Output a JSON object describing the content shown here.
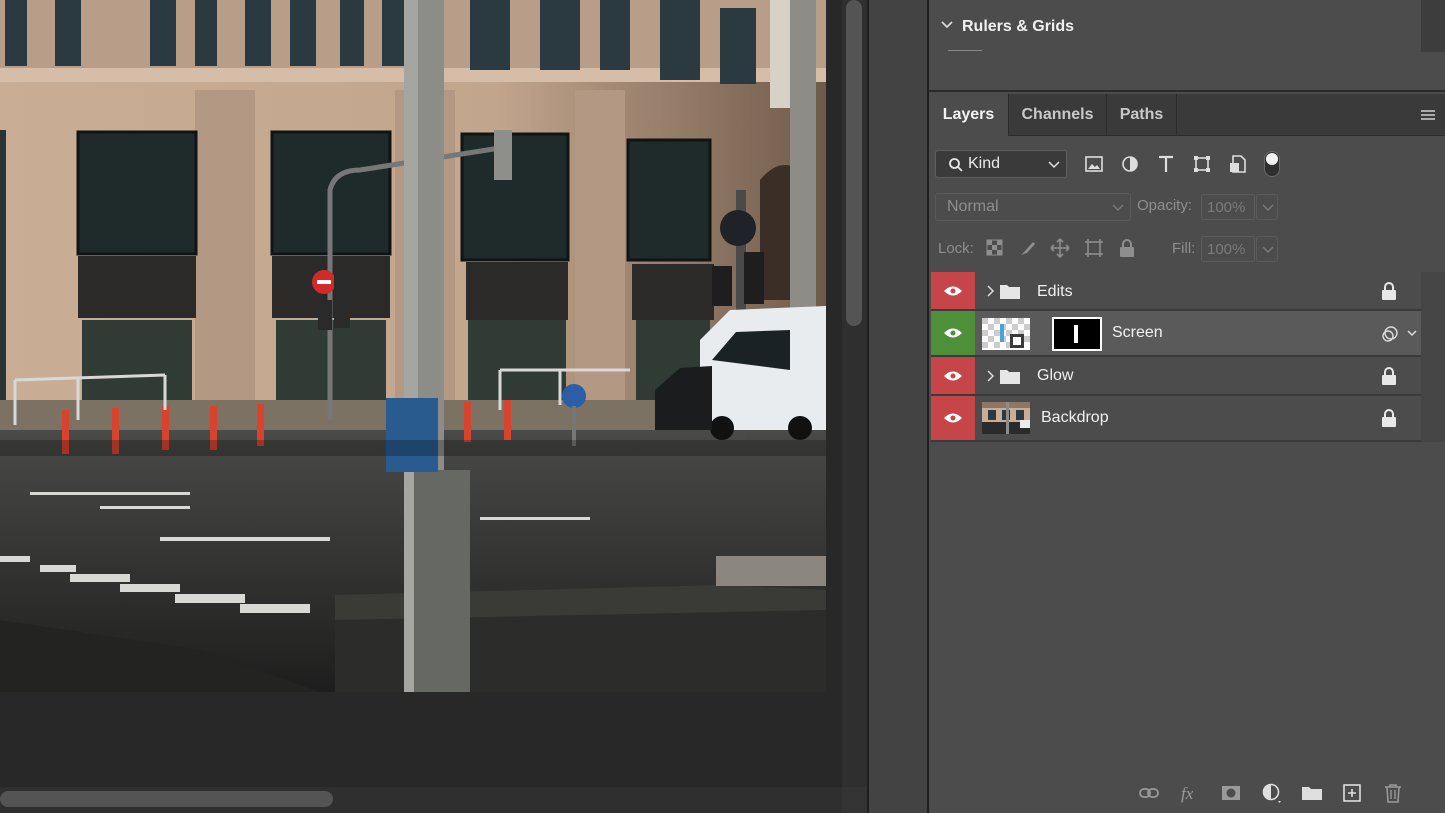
{
  "panels": {
    "rulers": {
      "title": "Rulers & Grids"
    },
    "tabs": [
      {
        "label": "Layers",
        "active": true
      },
      {
        "label": "Channels",
        "active": false
      },
      {
        "label": "Paths",
        "active": false
      }
    ],
    "filter": {
      "kind_label": "Kind"
    },
    "blend": {
      "mode": "Normal",
      "opacity_label": "Opacity:",
      "opacity_value": "100%"
    },
    "lock": {
      "label": "Lock:",
      "fill_label": "Fill:",
      "fill_value": "100%"
    },
    "layers": [
      {
        "name": "Edits",
        "type": "group",
        "eye_color": "#c64549",
        "locked": true
      },
      {
        "name": "Screen",
        "type": "smart-masked",
        "eye_color": "#4e8f3a",
        "locked": false,
        "selected": true
      },
      {
        "name": "Glow",
        "type": "group",
        "eye_color": "#c64549",
        "locked": true
      },
      {
        "name": "Backdrop",
        "type": "image",
        "eye_color": "#c64549",
        "locked": true
      }
    ]
  },
  "colors": {
    "panel_bg": "#4c4c4c",
    "tab_bar_bg": "#3a3a3a",
    "canvas_bg": "#282828",
    "eye_red": "#c64549",
    "eye_green": "#4e8f3a"
  }
}
